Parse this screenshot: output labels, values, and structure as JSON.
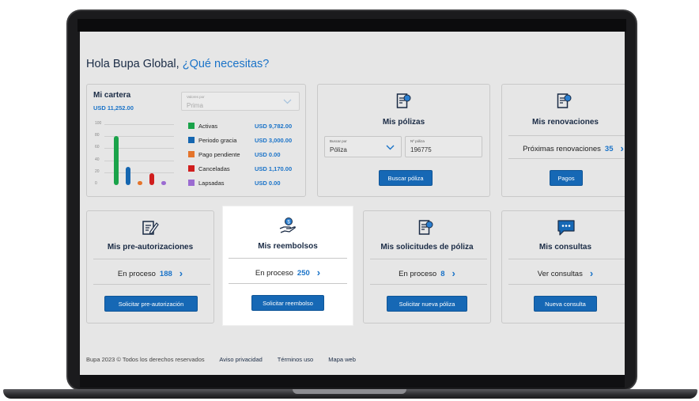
{
  "greeting": {
    "prefix": "Hola Bupa Global,",
    "question": "¿Qué necesitas?"
  },
  "cartera": {
    "title": "Mi cartera",
    "total": "USD 11,252.00",
    "select_label": "Valores por",
    "select_value": "Prima",
    "legend": [
      {
        "label": "Activas",
        "value": "USD 9,782.00",
        "color": "#1aa34a"
      },
      {
        "label": "Periodo gracia",
        "value": "USD 3,000.00",
        "color": "#1566b0"
      },
      {
        "label": "Pago pendiente",
        "value": "USD 0.00",
        "color": "#e4742b"
      },
      {
        "label": "Canceladas",
        "value": "USD 1,170.00",
        "color": "#d01e1e"
      },
      {
        "label": "Lapsadas",
        "value": "USD 0.00",
        "color": "#9b6bd1"
      }
    ],
    "y_ticks": [
      "100",
      "80",
      "60",
      "40",
      "20",
      "0"
    ]
  },
  "chart_data": {
    "type": "bar",
    "categories": [
      "Activas",
      "Periodo gracia",
      "Pago pendiente",
      "Canceladas",
      "Lapsadas"
    ],
    "values": [
      80,
      30,
      5,
      20,
      5
    ],
    "ylim": [
      0,
      100
    ],
    "colors": [
      "#1aa34a",
      "#1566b0",
      "#e4742b",
      "#d01e1e",
      "#9b6bd1"
    ],
    "grid": true
  },
  "polizas": {
    "title": "Mis pólizas",
    "buscar_label": "Buscar por",
    "buscar_value": "Póliza",
    "numero_label": "Nº póliza",
    "numero_value": "196775",
    "button": "Buscar póliza"
  },
  "renovaciones": {
    "title": "Mis renovaciones",
    "status_label": "Próximas renovaciones",
    "status_count": "35",
    "button": "Pagos"
  },
  "preautorizaciones": {
    "title": "Mis pre-autorizaciones",
    "status_label": "En proceso",
    "status_count": "188",
    "button": "Solicitar pre-autorización"
  },
  "reembolsos": {
    "title": "Mis reembolsos",
    "status_label": "En proceso",
    "status_count": "250",
    "button": "Solicitar reembolso"
  },
  "solicitudes": {
    "title": "Mis solicitudes de póliza",
    "status_label": "En proceso",
    "status_count": "8",
    "button": "Solicitar nueva póliza"
  },
  "consultas": {
    "title": "Mis consultas",
    "status_label": "Ver consultas",
    "button": "Nueva consulta"
  },
  "footer": {
    "copyright": "Bupa 2023 © Todos los derechos reservados",
    "privacy": "Aviso privacidad",
    "terms": "Términos uso",
    "sitemap": "Mapa web"
  },
  "colors": {
    "accent": "#1a73c8",
    "button": "#1668b5",
    "title": "#1a2b45"
  }
}
